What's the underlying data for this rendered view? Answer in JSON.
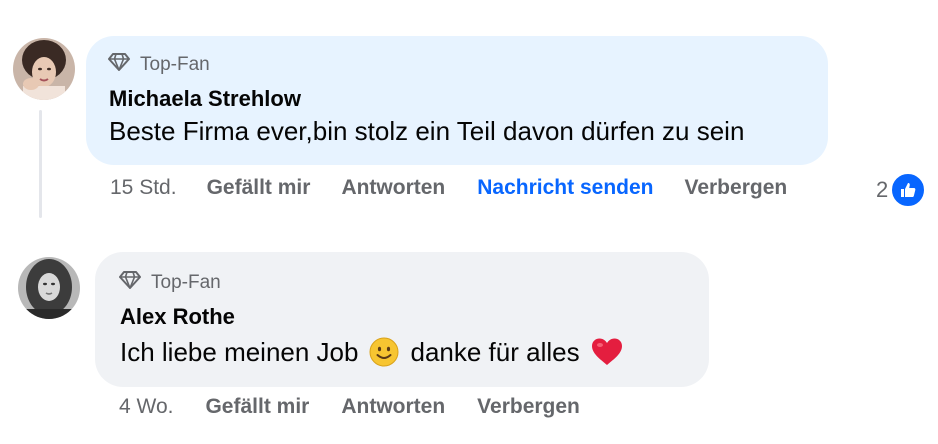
{
  "comments": [
    {
      "badge": "Top-Fan",
      "author": "Michaela Strehlow",
      "text": "Beste Firma ever,bin stolz ein Teil davon dürfen zu sein",
      "time": "15 Std.",
      "like_label": "Gefällt mir",
      "reply_label": "Antworten",
      "message_label": "Nachricht senden",
      "hide_label": "Verbergen",
      "reaction_count": "2",
      "bubble_color": "#e7f3ff"
    },
    {
      "badge": "Top-Fan",
      "author": "Alex Rothe",
      "text_part1": "Ich liebe meinen Job",
      "text_part2": "danke für alles",
      "time": "4 Wo.",
      "like_label": "Gefällt mir",
      "reply_label": "Antworten",
      "hide_label": "Verbergen",
      "bubble_color": "#f0f2f5"
    }
  ],
  "colors": {
    "link_blue": "#0866ff",
    "meta_grey": "#65676b",
    "heart_red": "#e41e3f"
  },
  "icons": [
    "diamond-icon",
    "like-reaction-icon",
    "smile-emoji-icon",
    "heart-emoji-icon"
  ]
}
